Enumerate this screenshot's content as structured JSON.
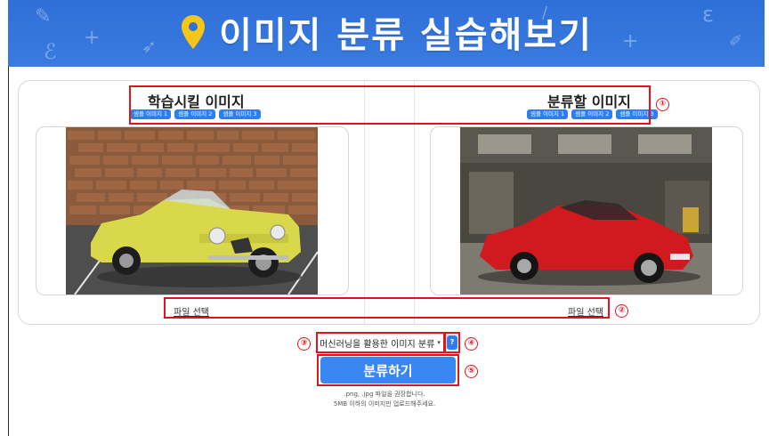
{
  "banner": {
    "title": "이미지 분류 실습해보기",
    "icon": "location-pin-icon",
    "color": "#2f6fd8"
  },
  "left_panel": {
    "title": "학습시킬 이미지",
    "sample_chips": [
      "샘플 이미지 1",
      "샘플 이미지 2",
      "샘플 이미지 3"
    ],
    "file_link": "파일 선택",
    "image": "yellow-convertible-car-photo"
  },
  "right_panel": {
    "title": "분류할 이미지",
    "sample_chips": [
      "샘플 이미지 1",
      "샘플 이미지 2",
      "샘플 이미지 3"
    ],
    "file_link": "파일 선택",
    "image": "red-coupe-car-photo"
  },
  "controls": {
    "model_select": "머신러닝을 활용한 이미지 분류",
    "help_label": "?",
    "classify_button": "분류하기",
    "note_line1": ".png, .jpg 파일을 권장합니다.",
    "note_line2": "5MB 이하의 이미지만 업로드해주세요."
  },
  "annotations": {
    "markers": [
      "①",
      "②",
      "③",
      "④",
      "⑤"
    ],
    "color": "#e0141e"
  },
  "accent_color": "#2e7ef0"
}
